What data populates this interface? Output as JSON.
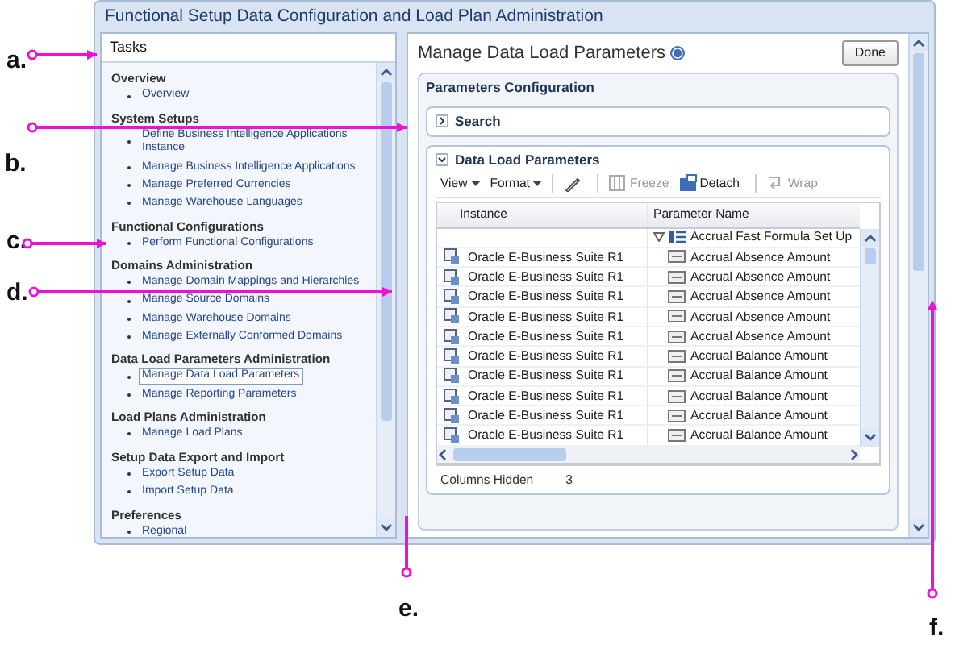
{
  "window": {
    "title": "Functional Setup Data Configuration and Load Plan Administration"
  },
  "tasks": {
    "title": "Tasks",
    "sections": [
      {
        "heading": "Overview",
        "items": [
          {
            "label": "Overview",
            "selected": false
          }
        ]
      },
      {
        "heading": "System Setups",
        "items": [
          {
            "label": "Define Business Intelligence Applications Instance",
            "selected": false
          },
          {
            "label": "Manage Business Intelligence Applications",
            "selected": false
          },
          {
            "label": "Manage Preferred Currencies",
            "selected": false
          },
          {
            "label": "Manage Warehouse Languages",
            "selected": false
          }
        ]
      },
      {
        "heading": "Functional Configurations",
        "items": [
          {
            "label": "Perform Functional Configurations",
            "selected": false
          }
        ]
      },
      {
        "heading": "Domains Administration",
        "items": [
          {
            "label": "Manage Domain Mappings and Hierarchies",
            "selected": false
          },
          {
            "label": "Manage Source Domains",
            "selected": false
          },
          {
            "label": "Manage Warehouse Domains",
            "selected": false
          },
          {
            "label": "Manage Externally Conformed Domains",
            "selected": false
          }
        ]
      },
      {
        "heading": "Data Load Parameters Administration",
        "items": [
          {
            "label": "Manage Data Load Parameters",
            "selected": true
          },
          {
            "label": "Manage Reporting Parameters",
            "selected": false
          }
        ]
      },
      {
        "heading": "Load Plans Administration",
        "items": [
          {
            "label": "Manage Load Plans",
            "selected": false
          }
        ]
      },
      {
        "heading": "Setup Data Export and Import",
        "items": [
          {
            "label": "Export Setup Data",
            "selected": false
          },
          {
            "label": "Import Setup Data",
            "selected": false
          }
        ]
      },
      {
        "heading": "Preferences",
        "items": [
          {
            "label": "Regional",
            "selected": false
          }
        ]
      }
    ]
  },
  "main": {
    "title": "Manage Data Load Parameters",
    "done_button": "Done",
    "section_title": "Parameters Configuration",
    "search": {
      "label": "Search",
      "expanded": false
    },
    "data_load": {
      "label": "Data Load Parameters",
      "expanded": true,
      "toolbar": [
        {
          "label": "View",
          "kind": "menu",
          "disabled": false
        },
        {
          "label": "Format",
          "kind": "menu",
          "disabled": false
        },
        {
          "kind": "pencil",
          "disabled": false
        },
        {
          "label": "Freeze",
          "kind": "freeze",
          "disabled": true
        },
        {
          "label": "Detach",
          "kind": "detach",
          "disabled": false
        },
        {
          "label": "Wrap",
          "kind": "wrap",
          "disabled": true
        }
      ],
      "columns": [
        "Instance",
        "Parameter Name"
      ],
      "group": {
        "label": "Accrual Fast Formula Set Up",
        "expanded": true
      },
      "rows": [
        {
          "instance": "Oracle E-Business Suite R1",
          "parameter": "Accrual Absence Amount"
        },
        {
          "instance": "Oracle E-Business Suite R1",
          "parameter": "Accrual Absence Amount"
        },
        {
          "instance": "Oracle E-Business Suite R1",
          "parameter": "Accrual Absence Amount"
        },
        {
          "instance": "Oracle E-Business Suite R1",
          "parameter": "Accrual Absence Amount"
        },
        {
          "instance": "Oracle E-Business Suite R1",
          "parameter": "Accrual Absence Amount"
        },
        {
          "instance": "Oracle E-Business Suite R1",
          "parameter": "Accrual Balance Amount"
        },
        {
          "instance": "Oracle E-Business Suite R1",
          "parameter": "Accrual Balance Amount"
        },
        {
          "instance": "Oracle E-Business Suite R1",
          "parameter": "Accrual Balance Amount"
        },
        {
          "instance": "Oracle E-Business Suite R1",
          "parameter": "Accrual Balance Amount"
        },
        {
          "instance": "Oracle E-Business Suite R1",
          "parameter": "Accrual Balance Amount"
        }
      ],
      "status": {
        "label": "Columns Hidden",
        "value": "3"
      }
    }
  },
  "callouts": [
    "a.",
    "b.",
    "c.",
    "d.",
    "e.",
    "f."
  ]
}
